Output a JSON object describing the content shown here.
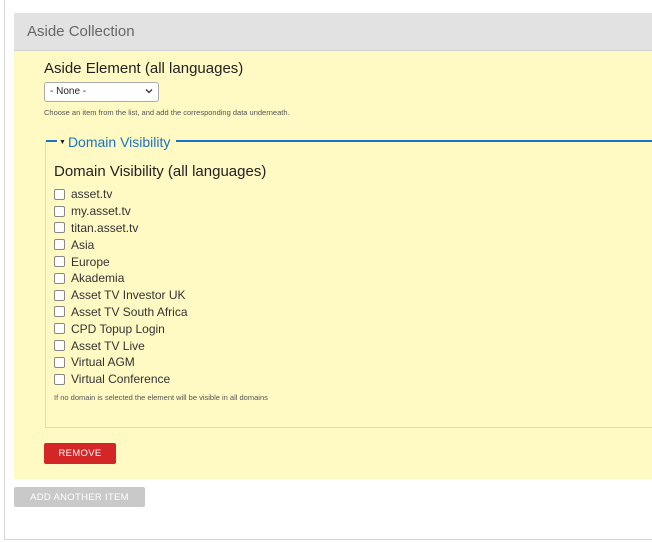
{
  "section": {
    "title": "Aside Collection"
  },
  "aside_element": {
    "label": "Aside Element (all languages)",
    "select_value": "- None -",
    "help_text": "Choose an item from the list, and add the corresponding data underneath."
  },
  "domain_visibility": {
    "legend": "Domain Visibility",
    "title": "Domain Visibility (all languages)",
    "options": [
      {
        "label": "asset.tv",
        "checked": false
      },
      {
        "label": "my.asset.tv",
        "checked": false
      },
      {
        "label": "titan.asset.tv",
        "checked": false
      },
      {
        "label": "Asia",
        "checked": false
      },
      {
        "label": "Europe",
        "checked": false
      },
      {
        "label": "Akademia",
        "checked": false
      },
      {
        "label": "Asset TV Investor UK",
        "checked": false
      },
      {
        "label": "Asset TV South Africa",
        "checked": false
      },
      {
        "label": "CPD Topup Login",
        "checked": false
      },
      {
        "label": "Asset TV Live",
        "checked": false
      },
      {
        "label": "Virtual AGM",
        "checked": false
      },
      {
        "label": "Virtual Conference",
        "checked": false
      }
    ],
    "note": "If no domain is selected the element will be visible in all domains"
  },
  "buttons": {
    "remove_label": "REMOVE",
    "add_label": "ADD ANOTHER ITEM"
  },
  "colors": {
    "panel_bg": "#fff9c4",
    "accent_blue": "#1a73c4",
    "remove_red": "#d42626",
    "disabled_gray": "#c9c9c9"
  }
}
